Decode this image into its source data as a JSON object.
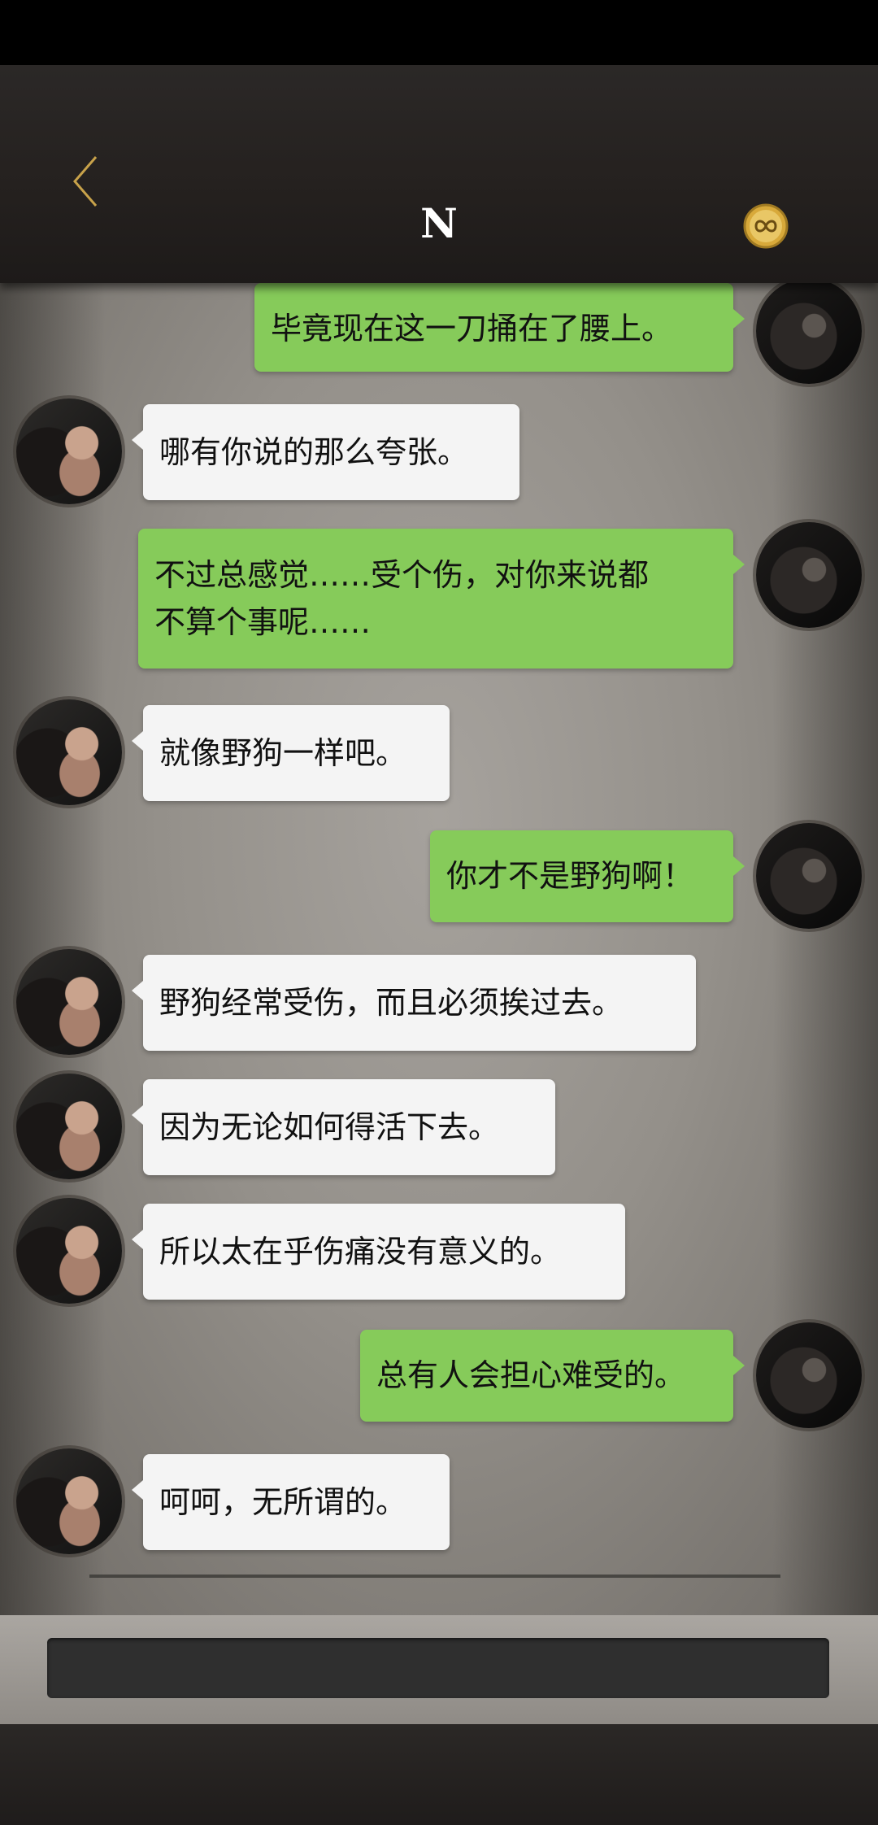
{
  "header": {
    "title": "N",
    "back_icon": "chevron-left-icon",
    "badge_icon": "infinity-coin-icon",
    "accent_color": "#c8a24a"
  },
  "messages": [
    {
      "side": "out",
      "text": "毕竟现在这一刀捅在了腰上。"
    },
    {
      "side": "in",
      "text": "哪有你说的那么夸张。"
    },
    {
      "side": "out",
      "lines": [
        "不过总感觉……受个伤，对你来说都",
        "不算个事呢……"
      ]
    },
    {
      "side": "in",
      "text": "就像野狗一样吧。"
    },
    {
      "side": "out",
      "text": "你才不是野狗啊！"
    },
    {
      "side": "in",
      "text": "野狗经常受伤，而且必须挨过去。"
    },
    {
      "side": "in",
      "text": "因为无论如何得活下去。"
    },
    {
      "side": "in",
      "text": "所以太在乎伤痛没有意义的。"
    },
    {
      "side": "out",
      "text": "总有人会担心难受的。"
    },
    {
      "side": "in",
      "text": "呵呵，无所谓的。"
    }
  ],
  "colors": {
    "incoming_bubble": "#f4f4f4",
    "outgoing_bubble": "#86cb5a"
  }
}
